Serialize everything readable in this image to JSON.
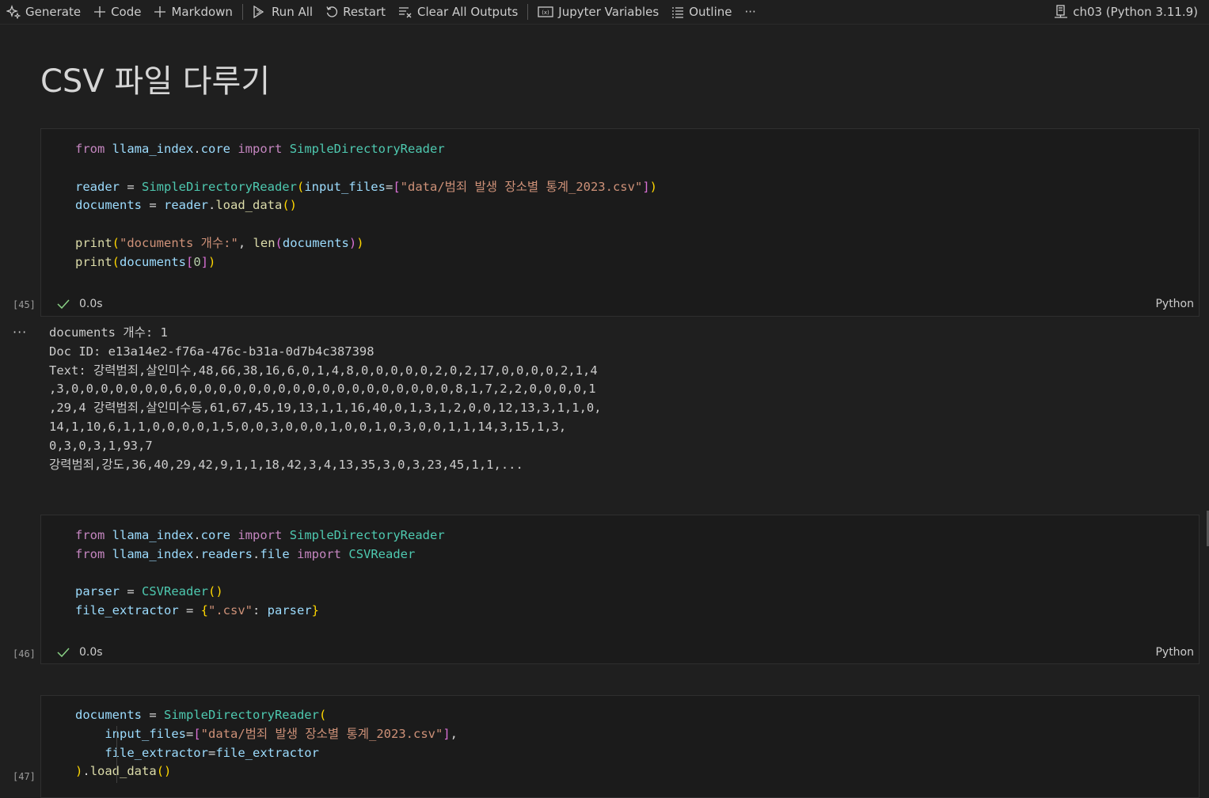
{
  "toolbar": {
    "generate": "Generate",
    "code": "Code",
    "markdown": "Markdown",
    "run_all": "Run All",
    "restart": "Restart",
    "clear_outputs": "Clear All Outputs",
    "variables": "Jupyter Variables",
    "outline": "Outline",
    "more": "···",
    "kernel": "ch03 (Python 3.11.9)"
  },
  "markdown_title": "CSV 파일 다루기",
  "cells": [
    {
      "exec_count": "[45]",
      "status": "0.0s",
      "language": "Python",
      "output_lines": [
        "documents 개수: 1",
        "Doc ID: e13a14e2-f76a-476c-b31a-0d7b4c387398",
        "Text: 강력범죄,살인미수,48,66,38,16,6,0,1,4,8,0,0,0,0,0,2,0,2,17,0,0,0,0,2,1,4",
        ",3,0,0,0,0,0,0,0,6,0,0,0,0,0,0,0,0,0,0,0,0,0,0,0,0,0,0,8,1,7,2,2,0,0,0,0,1",
        ",29,4 강력범죄,살인미수등,61,67,45,19,13,1,1,16,40,0,1,3,1,2,0,0,12,13,3,1,1,0,",
        "14,1,10,6,1,1,0,0,0,0,1,5,0,0,3,0,0,0,1,0,0,1,0,3,0,0,1,1,14,3,15,1,3,",
        "0,3,0,3,1,93,7",
        "강력범죄,강도,36,40,29,42,9,1,1,18,42,3,4,13,35,3,0,3,23,45,1,1,..."
      ]
    },
    {
      "exec_count": "[46]",
      "status": "0.0s",
      "language": "Python"
    },
    {
      "exec_count": "[47]"
    }
  ],
  "code": {
    "c1_l1": [
      "from",
      "llama_index",
      "core",
      "import",
      "SimpleDirectoryReader"
    ],
    "c1_l3": [
      "reader",
      "SimpleDirectoryReader",
      "input_files",
      "\"data/범죄 발생 장소별 통계_2023.csv\""
    ],
    "c1_l4": [
      "documents",
      "reader",
      "load_data"
    ],
    "c1_l6": [
      "print",
      "\"documents 개수:\"",
      "len",
      "documents"
    ],
    "c1_l7": [
      "print",
      "documents",
      "0"
    ],
    "c2_l1": [
      "from",
      "llama_index",
      "core",
      "import",
      "SimpleDirectoryReader"
    ],
    "c2_l2": [
      "from",
      "llama_index",
      "readers",
      "file",
      "import",
      "CSVReader"
    ],
    "c2_l4": [
      "parser",
      "CSVReader"
    ],
    "c2_l5": [
      "file_extractor",
      "\".csv\"",
      "parser"
    ],
    "c3_l1": [
      "documents",
      "SimpleDirectoryReader"
    ],
    "c3_l2": [
      "input_files",
      "\"data/범죄 발생 장소별 통계_2023.csv\""
    ],
    "c3_l3": [
      "file_extractor",
      "file_extractor"
    ],
    "c3_l4": [
      "load_data"
    ]
  }
}
